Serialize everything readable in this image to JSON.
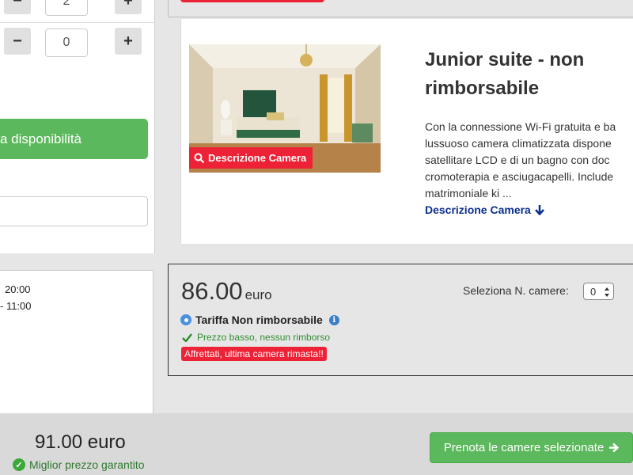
{
  "booking_form": {
    "stepper_top_value": "2",
    "stepper_bottom_value": "0",
    "minus_glyph": "−",
    "plus_glyph": "+",
    "availability_button": "a disponibilità",
    "promo_placeholder": ""
  },
  "hotel_times": {
    "check_in": "20:00",
    "check_out": "- 11:00"
  },
  "room": {
    "title": "Junior suite - non rimborsabile",
    "photo_button": "Descrizione Camera",
    "description_lines": [
      "Con la connessione Wi-Fi gratuita e ba",
      "lussuoso camera climatizzata dispone",
      "satellitare LCD e di un bagno con doc",
      "cromoterapia e asciugacapelli. Include",
      "matrimoniale ki ..."
    ],
    "description_link": "Descrizione Camera"
  },
  "rate": {
    "price": "86.00",
    "currency": "euro",
    "select_label": "Seleziona N. camere:",
    "rooms_selected": "0",
    "name": "Tariffa Non rimborsabile",
    "note": "Prezzo basso, nessun rimborso",
    "alert": "Affrettati, ultima camera rimasta!!"
  },
  "summary": {
    "total": "91.00 euro",
    "best_price": "Miglior prezzo garantito",
    "book_button": "Prenota le camere selezionate"
  },
  "colors": {
    "accent_green": "#5cb85c",
    "alert_red": "#ee2236",
    "link_blue": "#0b2f8f"
  }
}
